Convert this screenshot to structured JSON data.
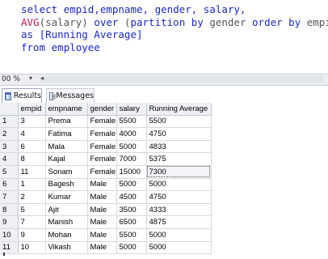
{
  "editor": {
    "line1": "select empid,empname, gender, salary,",
    "line2_fn": "AVG",
    "line2_p1": "(salary) ",
    "line2_kw1": "over ",
    "line2_p2": "(",
    "line2_kw2": "partition by ",
    "line2_p3": "gender ",
    "line2_kw3": "order by ",
    "line2_p4": "empid)",
    "line3_kw": "as ",
    "line3_rest": "[Running Average]",
    "line4_kw": "from ",
    "line4_rest": "employee"
  },
  "zoom": {
    "value": "00 %",
    "dropdown_icon": "chevron-down-icon"
  },
  "tabs": {
    "results": "Results",
    "messages": "Messages"
  },
  "grid": {
    "columns": [
      "",
      "empid",
      "empname",
      "gender",
      "salary",
      "Running Average"
    ],
    "rows": [
      [
        "1",
        "3",
        "Prema",
        "Female",
        "5500",
        "5500"
      ],
      [
        "2",
        "4",
        "Fatima",
        "Female",
        "4000",
        "4750"
      ],
      [
        "3",
        "6",
        "Mala",
        "Female",
        "5000",
        "4833"
      ],
      [
        "4",
        "8",
        "Kajal",
        "Female",
        "7000",
        "5375"
      ],
      [
        "5",
        "11",
        "Sonam",
        "Female",
        "15000",
        "7300"
      ],
      [
        "6",
        "1",
        "Bagesh",
        "Male",
        "5000",
        "5000"
      ],
      [
        "7",
        "2",
        "Kumar",
        "Male",
        "4500",
        "4750"
      ],
      [
        "8",
        "5",
        "Ajit",
        "Male",
        "3500",
        "4333"
      ],
      [
        "9",
        "7",
        "Manish",
        "Male",
        "6500",
        "4875"
      ],
      [
        "10",
        "9",
        "Mohan",
        "Male",
        "5500",
        "5000"
      ],
      [
        "11",
        "10",
        "Vikash",
        "Male",
        "5000",
        "5000"
      ]
    ]
  }
}
